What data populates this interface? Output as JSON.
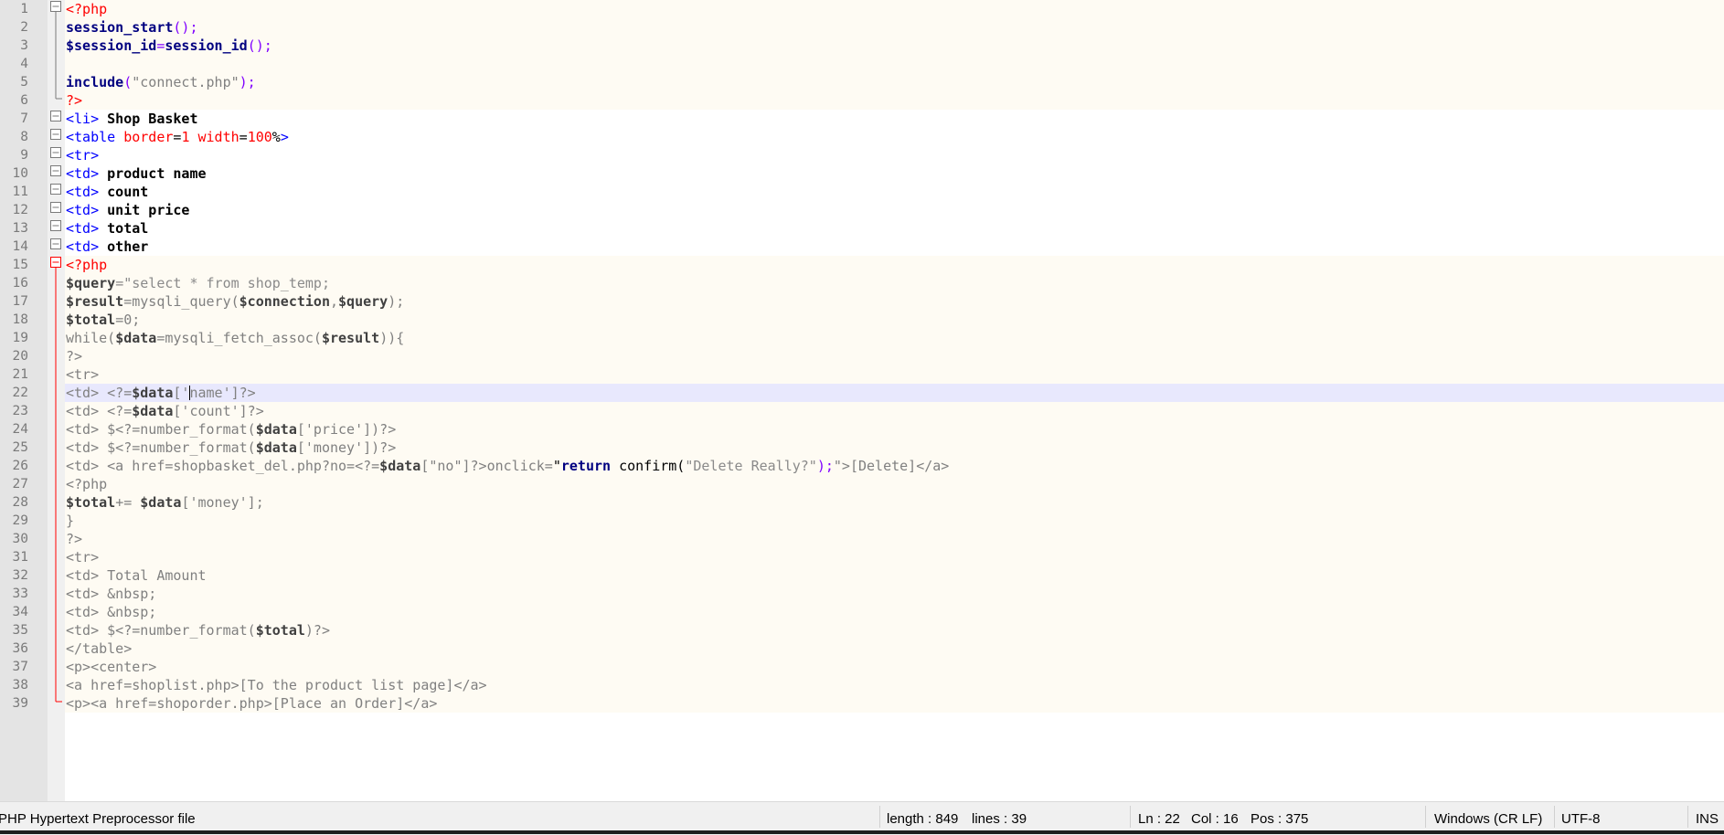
{
  "editor": {
    "current_line": 22,
    "lines": [
      {
        "n": "1",
        "bg": "php",
        "tokens": [
          [
            "<?php",
            "t-php"
          ]
        ]
      },
      {
        "n": "2",
        "bg": "php",
        "tokens": [
          [
            "session_start",
            "t-fn"
          ],
          [
            "();",
            "t-op"
          ]
        ]
      },
      {
        "n": "3",
        "bg": "php",
        "tokens": [
          [
            "$session_id",
            "t-var"
          ],
          [
            "=",
            "t-op"
          ],
          [
            "session_id",
            "t-fn"
          ],
          [
            "();",
            "t-op"
          ]
        ]
      },
      {
        "n": "4",
        "bg": "php",
        "tokens": []
      },
      {
        "n": "5",
        "bg": "php",
        "tokens": [
          [
            "include",
            "t-kw"
          ],
          [
            "(",
            "t-op"
          ],
          [
            "\"connect.php\"",
            "t-str"
          ],
          [
            ");",
            "t-op"
          ]
        ]
      },
      {
        "n": "6",
        "bg": "php",
        "tokens": [
          [
            "?>",
            "t-php"
          ]
        ]
      },
      {
        "n": "7",
        "bg": "",
        "tokens": [
          [
            "<li>",
            "t-tag"
          ],
          [
            " Shop Basket",
            "t-bold"
          ]
        ]
      },
      {
        "n": "8",
        "bg": "",
        "tokens": [
          [
            "<table ",
            "t-tag"
          ],
          [
            "border",
            "t-attr"
          ],
          [
            "=",
            "t-plain"
          ],
          [
            "1",
            "t-num"
          ],
          [
            " ",
            "t-plain"
          ],
          [
            "width",
            "t-attr"
          ],
          [
            "=",
            "t-plain"
          ],
          [
            "100",
            "t-num"
          ],
          [
            "%",
            "t-plain"
          ],
          [
            ">",
            "t-tag"
          ]
        ]
      },
      {
        "n": "9",
        "bg": "",
        "tokens": [
          [
            "<tr>",
            "t-tag"
          ]
        ]
      },
      {
        "n": "10",
        "bg": "",
        "tokens": [
          [
            "<td>",
            "t-tag"
          ],
          [
            " product name",
            "t-bold"
          ]
        ]
      },
      {
        "n": "11",
        "bg": "",
        "tokens": [
          [
            "<td>",
            "t-tag"
          ],
          [
            " count",
            "t-bold"
          ]
        ]
      },
      {
        "n": "12",
        "bg": "",
        "tokens": [
          [
            "<td>",
            "t-tag"
          ],
          [
            " unit price",
            "t-bold"
          ]
        ]
      },
      {
        "n": "13",
        "bg": "",
        "tokens": [
          [
            "<td>",
            "t-tag"
          ],
          [
            " total",
            "t-bold"
          ]
        ]
      },
      {
        "n": "14",
        "bg": "",
        "tokens": [
          [
            "<td>",
            "t-tag"
          ],
          [
            " other",
            "t-bold"
          ]
        ]
      },
      {
        "n": "15",
        "bg": "php",
        "tokens": [
          [
            "<?php",
            "t-php"
          ]
        ]
      },
      {
        "n": "16",
        "bg": "php",
        "tokens": [
          [
            "$query",
            "t-gvar"
          ],
          [
            "=\"select * from shop_temp;",
            "t-gstr"
          ]
        ]
      },
      {
        "n": "17",
        "bg": "php",
        "tokens": [
          [
            "$result",
            "t-gvar"
          ],
          [
            "=mysqli_query(",
            "t-grey"
          ],
          [
            "$connection",
            "t-gvar"
          ],
          [
            ",",
            "t-grey"
          ],
          [
            "$query",
            "t-gvar"
          ],
          [
            ");",
            "t-grey"
          ]
        ]
      },
      {
        "n": "18",
        "bg": "php",
        "tokens": [
          [
            "$total",
            "t-gvar"
          ],
          [
            "=0;",
            "t-grey"
          ]
        ]
      },
      {
        "n": "19",
        "bg": "php",
        "tokens": [
          [
            "while(",
            "t-grey"
          ],
          [
            "$data",
            "t-gvar"
          ],
          [
            "=mysqli_fetch_assoc(",
            "t-grey"
          ],
          [
            "$result",
            "t-gvar"
          ],
          [
            ")){",
            "t-grey"
          ]
        ]
      },
      {
        "n": "20",
        "bg": "php",
        "tokens": [
          [
            "?>",
            "t-grey"
          ]
        ]
      },
      {
        "n": "21",
        "bg": "php",
        "tokens": [
          [
            "<tr>",
            "t-grey"
          ]
        ]
      },
      {
        "n": "22",
        "bg": "cur",
        "tokens": [
          [
            "<td> <?=",
            "t-grey"
          ],
          [
            "$data",
            "t-gvar"
          ],
          [
            "['",
            "t-grey"
          ],
          [
            "CARET",
            ""
          ],
          [
            "name']?>",
            "t-grey"
          ]
        ]
      },
      {
        "n": "23",
        "bg": "php",
        "tokens": [
          [
            "<td> <?=",
            "t-grey"
          ],
          [
            "$data",
            "t-gvar"
          ],
          [
            "['count']?>",
            "t-grey"
          ]
        ]
      },
      {
        "n": "24",
        "bg": "php",
        "tokens": [
          [
            "<td> $<?=number_format(",
            "t-grey"
          ],
          [
            "$data",
            "t-gvar"
          ],
          [
            "['price'])?>",
            "t-grey"
          ]
        ]
      },
      {
        "n": "25",
        "bg": "php",
        "tokens": [
          [
            "<td> $<?=number_format(",
            "t-grey"
          ],
          [
            "$data",
            "t-gvar"
          ],
          [
            "['money'])?>",
            "t-grey"
          ]
        ]
      },
      {
        "n": "26",
        "bg": "php",
        "tokens": [
          [
            "<td> <a href=shopbasket_del.php?no=<?=",
            "t-grey"
          ],
          [
            "$data",
            "t-gvar"
          ],
          [
            "[\"no\"]?>onclick=",
            "t-grey"
          ],
          [
            "\"",
            "t-plain"
          ],
          [
            "return",
            "t-gkw"
          ],
          [
            " confirm(",
            "t-plain"
          ],
          [
            "\"Delete Really?\"",
            "t-gstr"
          ],
          [
            ");",
            "t-op"
          ],
          [
            "\">[Delete]</a>",
            "t-grey"
          ]
        ]
      },
      {
        "n": "27",
        "bg": "php",
        "tokens": [
          [
            "<?php",
            "t-grey"
          ]
        ]
      },
      {
        "n": "28",
        "bg": "php",
        "tokens": [
          [
            "$total",
            "t-gvar"
          ],
          [
            "+= ",
            "t-grey"
          ],
          [
            "$data",
            "t-gvar"
          ],
          [
            "['money'];",
            "t-grey"
          ]
        ]
      },
      {
        "n": "29",
        "bg": "php",
        "tokens": [
          [
            "}",
            "t-grey"
          ]
        ]
      },
      {
        "n": "30",
        "bg": "php",
        "tokens": [
          [
            "?>",
            "t-grey"
          ]
        ]
      },
      {
        "n": "31",
        "bg": "php",
        "tokens": [
          [
            "<tr>",
            "t-grey"
          ]
        ]
      },
      {
        "n": "32",
        "bg": "php",
        "tokens": [
          [
            "<td> Total Amount",
            "t-grey"
          ]
        ]
      },
      {
        "n": "33",
        "bg": "php",
        "tokens": [
          [
            "<td> &nbsp;",
            "t-grey"
          ]
        ]
      },
      {
        "n": "34",
        "bg": "php",
        "tokens": [
          [
            "<td> &nbsp;",
            "t-grey"
          ]
        ]
      },
      {
        "n": "35",
        "bg": "php",
        "tokens": [
          [
            "<td> $<?=number_format(",
            "t-grey"
          ],
          [
            "$total",
            "t-gvar"
          ],
          [
            ")?>",
            "t-grey"
          ]
        ]
      },
      {
        "n": "36",
        "bg": "php",
        "tokens": [
          [
            "</table>",
            "t-grey"
          ]
        ]
      },
      {
        "n": "37",
        "bg": "php",
        "tokens": [
          [
            "<p><center>",
            "t-grey"
          ]
        ]
      },
      {
        "n": "38",
        "bg": "php",
        "tokens": [
          [
            "<a href=shoplist.php>[To the product list page]</a>",
            "t-grey"
          ]
        ]
      },
      {
        "n": "39",
        "bg": "php",
        "tokens": [
          [
            "<p><a href=shoporder.php>[Place an Order]</a>",
            "t-grey"
          ]
        ]
      }
    ]
  },
  "statusbar": {
    "file_type": "PHP Hypertext Preprocessor file",
    "length": "length : 849",
    "lines": "lines : 39",
    "ln": "Ln : 22",
    "col": "Col : 16",
    "pos": "Pos : 375",
    "eol": "Windows (CR LF)",
    "encoding": "UTF-8",
    "mode": "INS"
  }
}
